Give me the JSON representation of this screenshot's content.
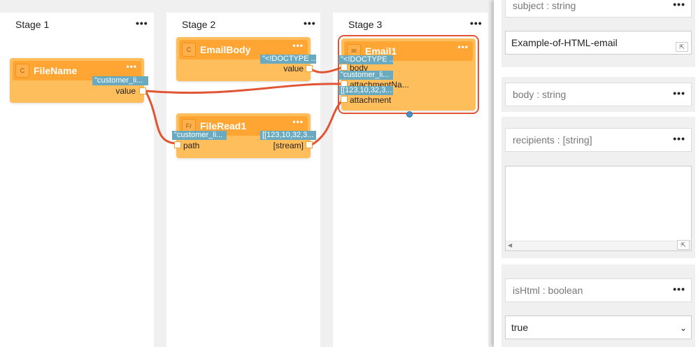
{
  "stages": [
    {
      "title": "Stage 1",
      "menu": "•••"
    },
    {
      "title": "Stage 2",
      "menu": "•••"
    },
    {
      "title": "Stage 3",
      "menu": "•••"
    }
  ],
  "nodes": {
    "filename": {
      "icon": "C",
      "title": "FileName",
      "menu": "•••",
      "value_tag": "\"customer_li...",
      "port_label": "value"
    },
    "emailbody": {
      "icon": "C",
      "title": "EmailBody",
      "menu": "•••",
      "value_tag": "\"<!DOCTYPE ...",
      "port_label": "value"
    },
    "fileread": {
      "icon": "Fr",
      "title": "FileRead1",
      "menu": "•••",
      "in_tag": "\"customer_li...",
      "in_label": "path",
      "out_tag": "[[123,10,32,3...",
      "out_label": "[stream]"
    },
    "email": {
      "icon": "✉",
      "title": "Email1",
      "menu": "•••",
      "ports": [
        {
          "tag": "\"<!DOCTYPE ...",
          "label": "body"
        },
        {
          "tag": "\"customer_li...",
          "label": "attachmentNa..."
        },
        {
          "tag": "[[123,10,32,3...",
          "label": "attachment"
        }
      ]
    }
  },
  "panel": {
    "subject_label": "subject : string",
    "subject_menu": "•••",
    "subject_value": "Example-of-HTML-email",
    "expand_glyph": "⇱",
    "body_label": "body : string",
    "body_menu": "•••",
    "recipients_label": "recipients : [string]",
    "recipients_menu": "•••",
    "recipients_value": "",
    "scroll_left_glyph": "◀",
    "ishtml_label": "isHtml : boolean",
    "ishtml_menu": "•••",
    "ishtml_value": "true",
    "select_chevron": "⌄"
  },
  "colors": {
    "node_body": "#ffbe5c",
    "node_header": "#ffa533",
    "value_tag": "#6aaac0",
    "wire": "#e05533",
    "selection": "#e05533"
  }
}
